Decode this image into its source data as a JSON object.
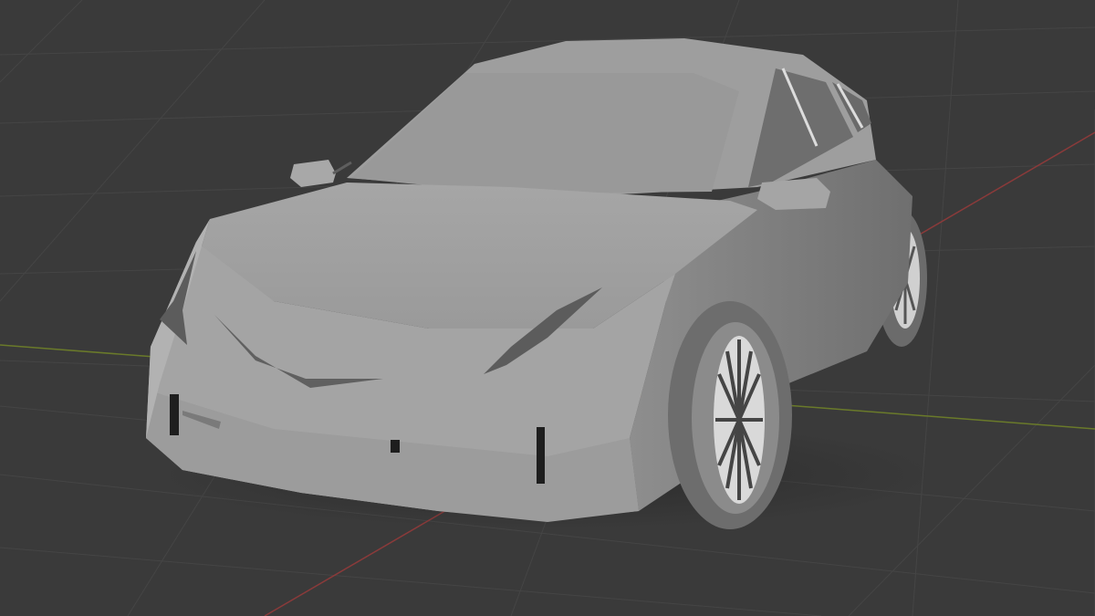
{
  "viewport": {
    "background_color": "#3a3a3a",
    "grid_line_color": "#454545",
    "x_axis_color": "#8a3a3a",
    "y_axis_color": "#6a7a2a",
    "model_base_color": "#a9a9a9"
  }
}
